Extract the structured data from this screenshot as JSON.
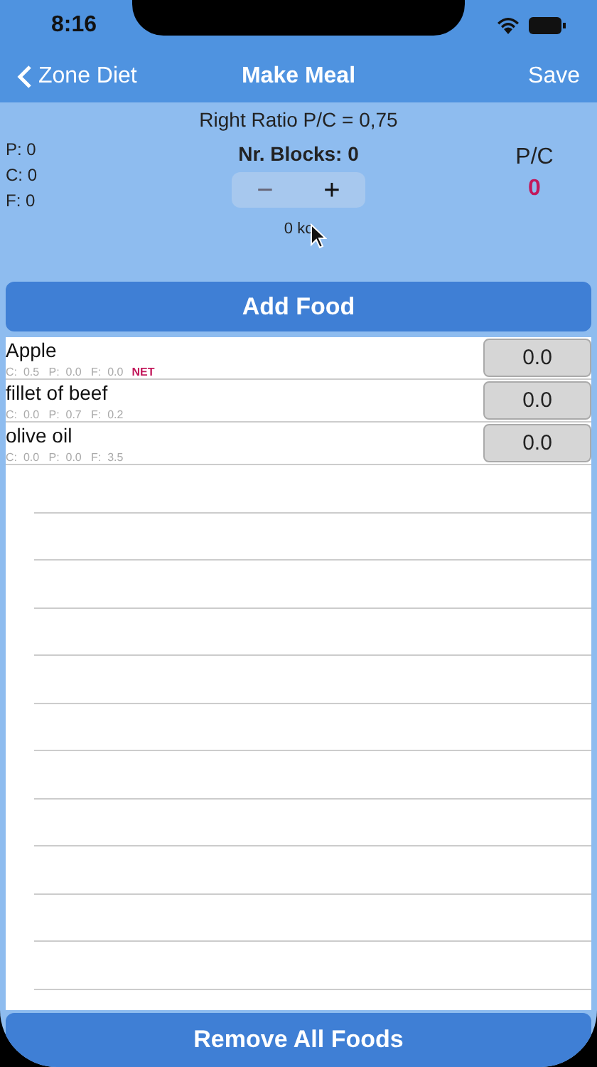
{
  "status_bar": {
    "time": "8:16"
  },
  "nav": {
    "back": "Zone Diet",
    "title": "Make Meal",
    "action": "Save"
  },
  "summary": {
    "ratio": "Right Ratio P/C = 0,75",
    "blocks": "Nr. Blocks: 0",
    "totals": [
      "P: 0",
      "C: 0",
      "F: 0"
    ],
    "stepper": {
      "minus": "−",
      "plus": "+"
    },
    "kcal": "0 kc",
    "pc_label": "P/C",
    "pc_value": "0"
  },
  "add_button": "Add Food",
  "foods": [
    {
      "name": "Apple",
      "macros": "C:  0.5   P:  0.0   F:  0.0",
      "tag": "NET",
      "quantity": "0.0"
    },
    {
      "name": "fillet of beef",
      "macros": "C:  0.0   P:  0.7   F:  0.2",
      "quantity": "0.0"
    },
    {
      "name": "olive oil",
      "macros": "C:  0.0   P:  0.0   F:  3.5",
      "quantity": "0.0"
    }
  ],
  "remove_button": "Remove All Foods"
}
